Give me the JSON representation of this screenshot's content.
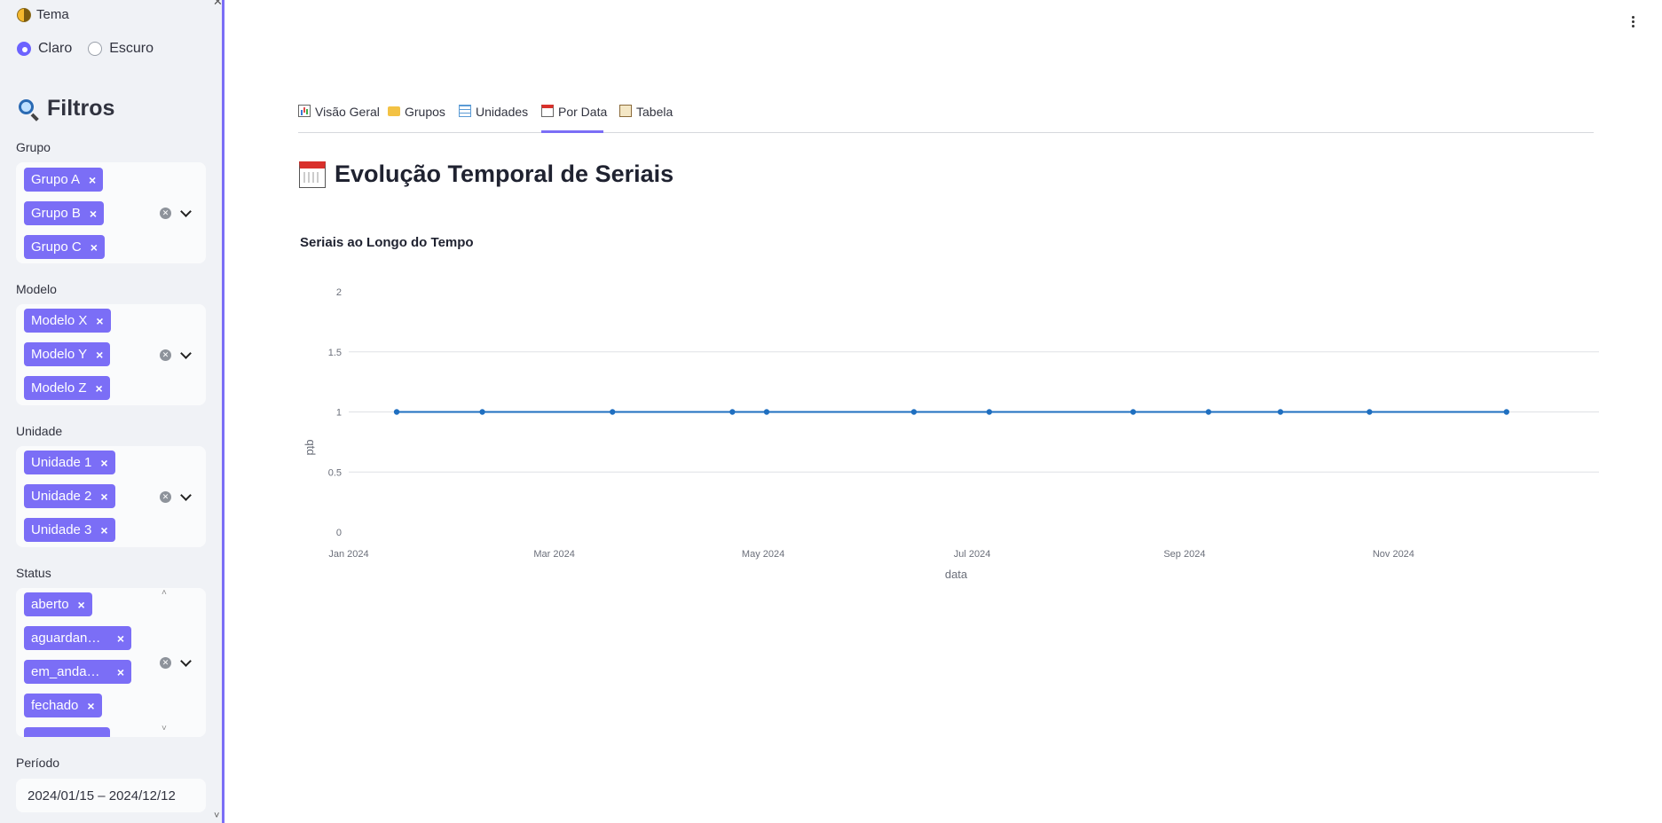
{
  "sidebar": {
    "theme_label": "Tema",
    "theme_options": [
      "Claro",
      "Escuro"
    ],
    "theme_selected": "Claro",
    "filters_title": "Filtros",
    "groups": [
      {
        "label": "Grupo",
        "chips": [
          "Grupo A",
          "Grupo B",
          "Grupo C"
        ]
      },
      {
        "label": "Modelo",
        "chips": [
          "Modelo X",
          "Modelo Y",
          "Modelo Z"
        ]
      },
      {
        "label": "Unidade",
        "chips": [
          "Unidade 1",
          "Unidade 2",
          "Unidade 3"
        ]
      },
      {
        "label": "Status",
        "chips": [
          "aberto",
          "aguardan…",
          "em_anda…",
          "fechado"
        ]
      }
    ],
    "period_label": "Período",
    "period_value": "2024/01/15 – 2024/12/12"
  },
  "tabs": [
    {
      "label": "Visão Geral",
      "icon": "bar-chart-icon"
    },
    {
      "label": "Grupos",
      "icon": "folder-icon"
    },
    {
      "label": "Unidades",
      "icon": "grid-icon"
    },
    {
      "label": "Por Data",
      "icon": "calendar-icon",
      "active": true
    },
    {
      "label": "Tabela",
      "icon": "clipboard-icon"
    }
  ],
  "main": {
    "title": "Evolução Temporal de Seriais"
  },
  "chart_data": {
    "type": "line",
    "title": "Seriais ao Longo do Tempo",
    "xlabel": "data",
    "ylabel": "qtd",
    "ylim": [
      0,
      2
    ],
    "xlim": [
      "2024-01-01",
      "2024-12-31"
    ],
    "yticks": [
      "0",
      "0.5",
      "1",
      "1.5",
      "2"
    ],
    "xticks": [
      {
        "date": "2024-01-01",
        "label": "Jan 2024"
      },
      {
        "date": "2024-03-01",
        "label": "Mar 2024"
      },
      {
        "date": "2024-05-01",
        "label": "May 2024"
      },
      {
        "date": "2024-07-01",
        "label": "Jul 2024"
      },
      {
        "date": "2024-09-01",
        "label": "Sep 2024"
      },
      {
        "date": "2024-11-01",
        "label": "Nov 2024"
      }
    ],
    "x": [
      "2024-01-15",
      "2024-02-09",
      "2024-03-18",
      "2024-04-22",
      "2024-05-02",
      "2024-06-14",
      "2024-07-06",
      "2024-08-17",
      "2024-09-08",
      "2024-09-29",
      "2024-10-25",
      "2024-12-04"
    ],
    "y": [
      1,
      1,
      1,
      1,
      1,
      1,
      1,
      1,
      1,
      1,
      1,
      1
    ],
    "grid": true,
    "color": "#1f6fc0"
  }
}
